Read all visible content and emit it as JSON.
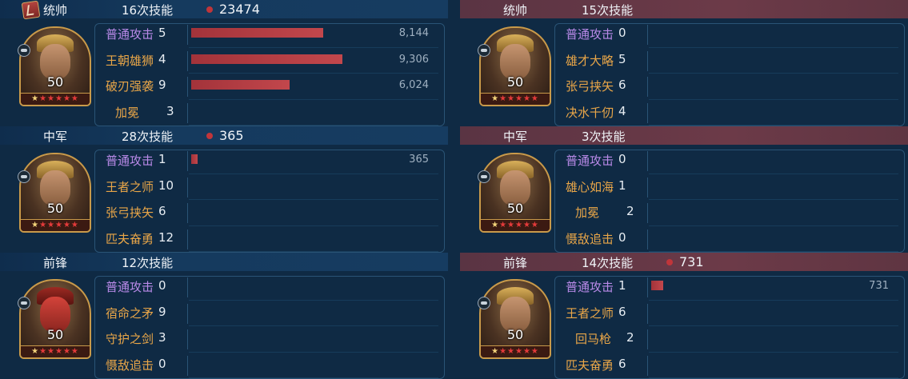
{
  "left": [
    {
      "role": "统帅",
      "skill_count": "16次技能",
      "damage": "23474",
      "header_icon": "flag-icon",
      "level": "50",
      "skills": [
        {
          "name": "普通攻击",
          "count": "5",
          "color": "purple",
          "bar_fraction": 0.55,
          "value": "8,144"
        },
        {
          "name": "王朝雄狮",
          "count": "4",
          "color": "orange",
          "bar_fraction": 0.63,
          "value": "9,306"
        },
        {
          "name": "破刃强袭",
          "count": "9",
          "color": "orange",
          "bar_fraction": 0.41,
          "value": "6,024"
        },
        {
          "name": "加冕",
          "count": "3",
          "color": "orange",
          "indent": true,
          "bar_fraction": 0,
          "value": ""
        }
      ]
    },
    {
      "role": "中军",
      "skill_count": "28次技能",
      "damage": "365",
      "header_icon": "star-icon",
      "level": "50",
      "skills": [
        {
          "name": "普通攻击",
          "count": "1",
          "color": "purple",
          "bar_fraction": 0.025,
          "value": "365"
        },
        {
          "name": "王者之师",
          "count": "10",
          "color": "orange",
          "bar_fraction": 0,
          "value": ""
        },
        {
          "name": "张弓挟矢",
          "count": "6",
          "color": "orange",
          "bar_fraction": 0,
          "value": ""
        },
        {
          "name": "匹夫奋勇",
          "count": "12",
          "color": "orange",
          "bar_fraction": 0,
          "value": ""
        }
      ]
    },
    {
      "role": "前锋",
      "skill_count": "12次技能",
      "damage": "",
      "header_icon": "star-icon",
      "level": "50",
      "skills": [
        {
          "name": "普通攻击",
          "count": "0",
          "color": "purple",
          "bar_fraction": 0,
          "value": ""
        },
        {
          "name": "宿命之矛",
          "count": "9",
          "color": "orange",
          "bar_fraction": 0,
          "value": ""
        },
        {
          "name": "守护之剑",
          "count": "3",
          "color": "orange",
          "bar_fraction": 0,
          "value": ""
        },
        {
          "name": "慑敌追击",
          "count": "0",
          "color": "orange",
          "bar_fraction": 0,
          "value": ""
        }
      ]
    }
  ],
  "right": [
    {
      "role": "统帅",
      "skill_count": "15次技能",
      "damage": "",
      "header_icon": "star-icon",
      "level": "50",
      "skills": [
        {
          "name": "普通攻击",
          "count": "0",
          "color": "purple",
          "bar_fraction": 0,
          "value": ""
        },
        {
          "name": "雄才大略",
          "count": "5",
          "color": "orange",
          "bar_fraction": 0,
          "value": ""
        },
        {
          "name": "张弓挟矢",
          "count": "6",
          "color": "orange",
          "bar_fraction": 0,
          "value": ""
        },
        {
          "name": "决水千仞",
          "count": "4",
          "color": "orange",
          "bar_fraction": 0,
          "value": ""
        }
      ]
    },
    {
      "role": "中军",
      "skill_count": "3次技能",
      "damage": "",
      "header_icon": "star-icon",
      "level": "50",
      "skills": [
        {
          "name": "普通攻击",
          "count": "0",
          "color": "purple",
          "bar_fraction": 0,
          "value": ""
        },
        {
          "name": "雄心如海",
          "count": "1",
          "color": "orange",
          "bar_fraction": 0,
          "value": ""
        },
        {
          "name": "加冕",
          "count": "2",
          "color": "orange",
          "indent": true,
          "bar_fraction": 0,
          "value": ""
        },
        {
          "name": "慑敌追击",
          "count": "0",
          "color": "orange",
          "bar_fraction": 0,
          "value": ""
        }
      ]
    },
    {
      "role": "前锋",
      "skill_count": "14次技能",
      "damage": "731",
      "header_icon": "star-icon",
      "level": "50",
      "skills": [
        {
          "name": "普通攻击",
          "count": "1",
          "color": "purple",
          "bar_fraction": 0.05,
          "value": "731"
        },
        {
          "name": "王者之师",
          "count": "6",
          "color": "orange",
          "bar_fraction": 0,
          "value": ""
        },
        {
          "name": "回马枪",
          "count": "2",
          "color": "orange",
          "indent": true,
          "bar_fraction": 0,
          "value": ""
        },
        {
          "name": "匹夫奋勇",
          "count": "6",
          "color": "orange",
          "bar_fraction": 0,
          "value": ""
        }
      ]
    }
  ],
  "stars": "★★★★★★",
  "colors": {
    "left_header": "#153a5e",
    "right_header": "#6c3a48",
    "bar": "#c2474c",
    "skill_purple": "#b98ae8",
    "skill_orange": "#e9a648"
  }
}
